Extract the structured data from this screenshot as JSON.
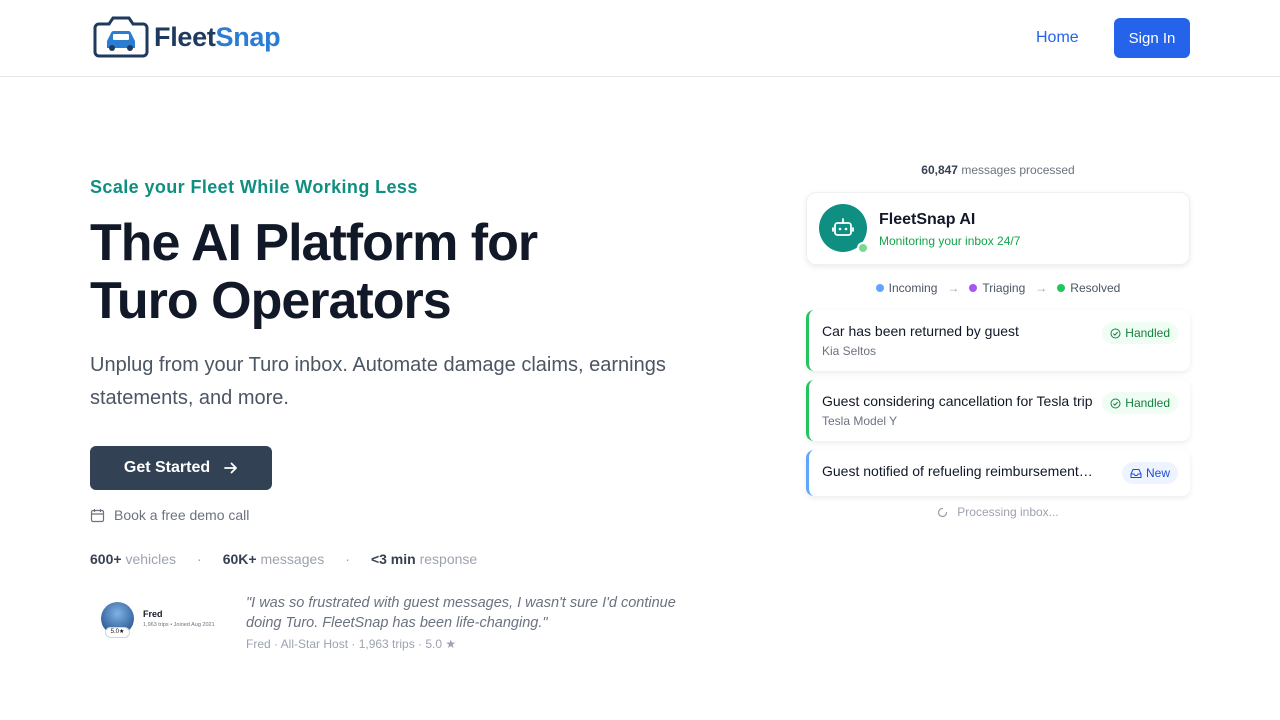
{
  "header": {
    "logo_part1": "Fleet",
    "logo_part2": "Snap",
    "nav_home": "Home",
    "sign_in": "Sign In"
  },
  "hero": {
    "eyebrow": "Scale your Fleet While Working Less",
    "headline_line1": "The AI Platform for",
    "headline_line2": "Turo Operators",
    "subhead": "Unplug from your Turo inbox. Automate damage claims, earnings statements, and more.",
    "cta": "Get Started",
    "demo": "Book a free demo call",
    "stats": [
      {
        "value": "600+",
        "label": "vehicles"
      },
      {
        "value": "60K+",
        "label": "messages"
      },
      {
        "value": "<3 min",
        "label": "response"
      }
    ],
    "stat_separator": "·"
  },
  "testimonial": {
    "card_name": "Fred",
    "card_meta": "1,963 trips • Joined Aug 2021",
    "card_rating": "5.0★",
    "quote": "\"I was so frustrated with guest messages, I wasn't sure I'd continue doing Turo. FleetSnap has been life-changing.\"",
    "attribution": "Fred · All-Star Host · 1,963 trips · 5.0 ★"
  },
  "panel": {
    "processed_count": "60,847",
    "processed_label": "messages processed",
    "ai_name": "FleetSnap AI",
    "ai_status": "Monitoring your inbox 24/7",
    "pipeline": [
      {
        "label": "Incoming",
        "color": "#60a5fa"
      },
      {
        "label": "Triaging",
        "color": "#a855f7"
      },
      {
        "label": "Resolved",
        "color": "#22c55e"
      }
    ],
    "messages": [
      {
        "title": "Car has been returned by guest",
        "vehicle": "Kia Seltos",
        "status": "Handled"
      },
      {
        "title": "Guest considering cancellation for Tesla trip",
        "vehicle": "Tesla Model Y",
        "status": "Handled"
      },
      {
        "title": "Guest notified of refueling reimbursement…",
        "vehicle": "",
        "status": "New"
      }
    ],
    "processing": "Processing inbox..."
  },
  "colors": {
    "accent_blue": "#2563eb",
    "teal": "#0f8f82",
    "dark_button": "#334155",
    "handled_green": "#22c55e",
    "new_blue": "#60a5fa"
  }
}
